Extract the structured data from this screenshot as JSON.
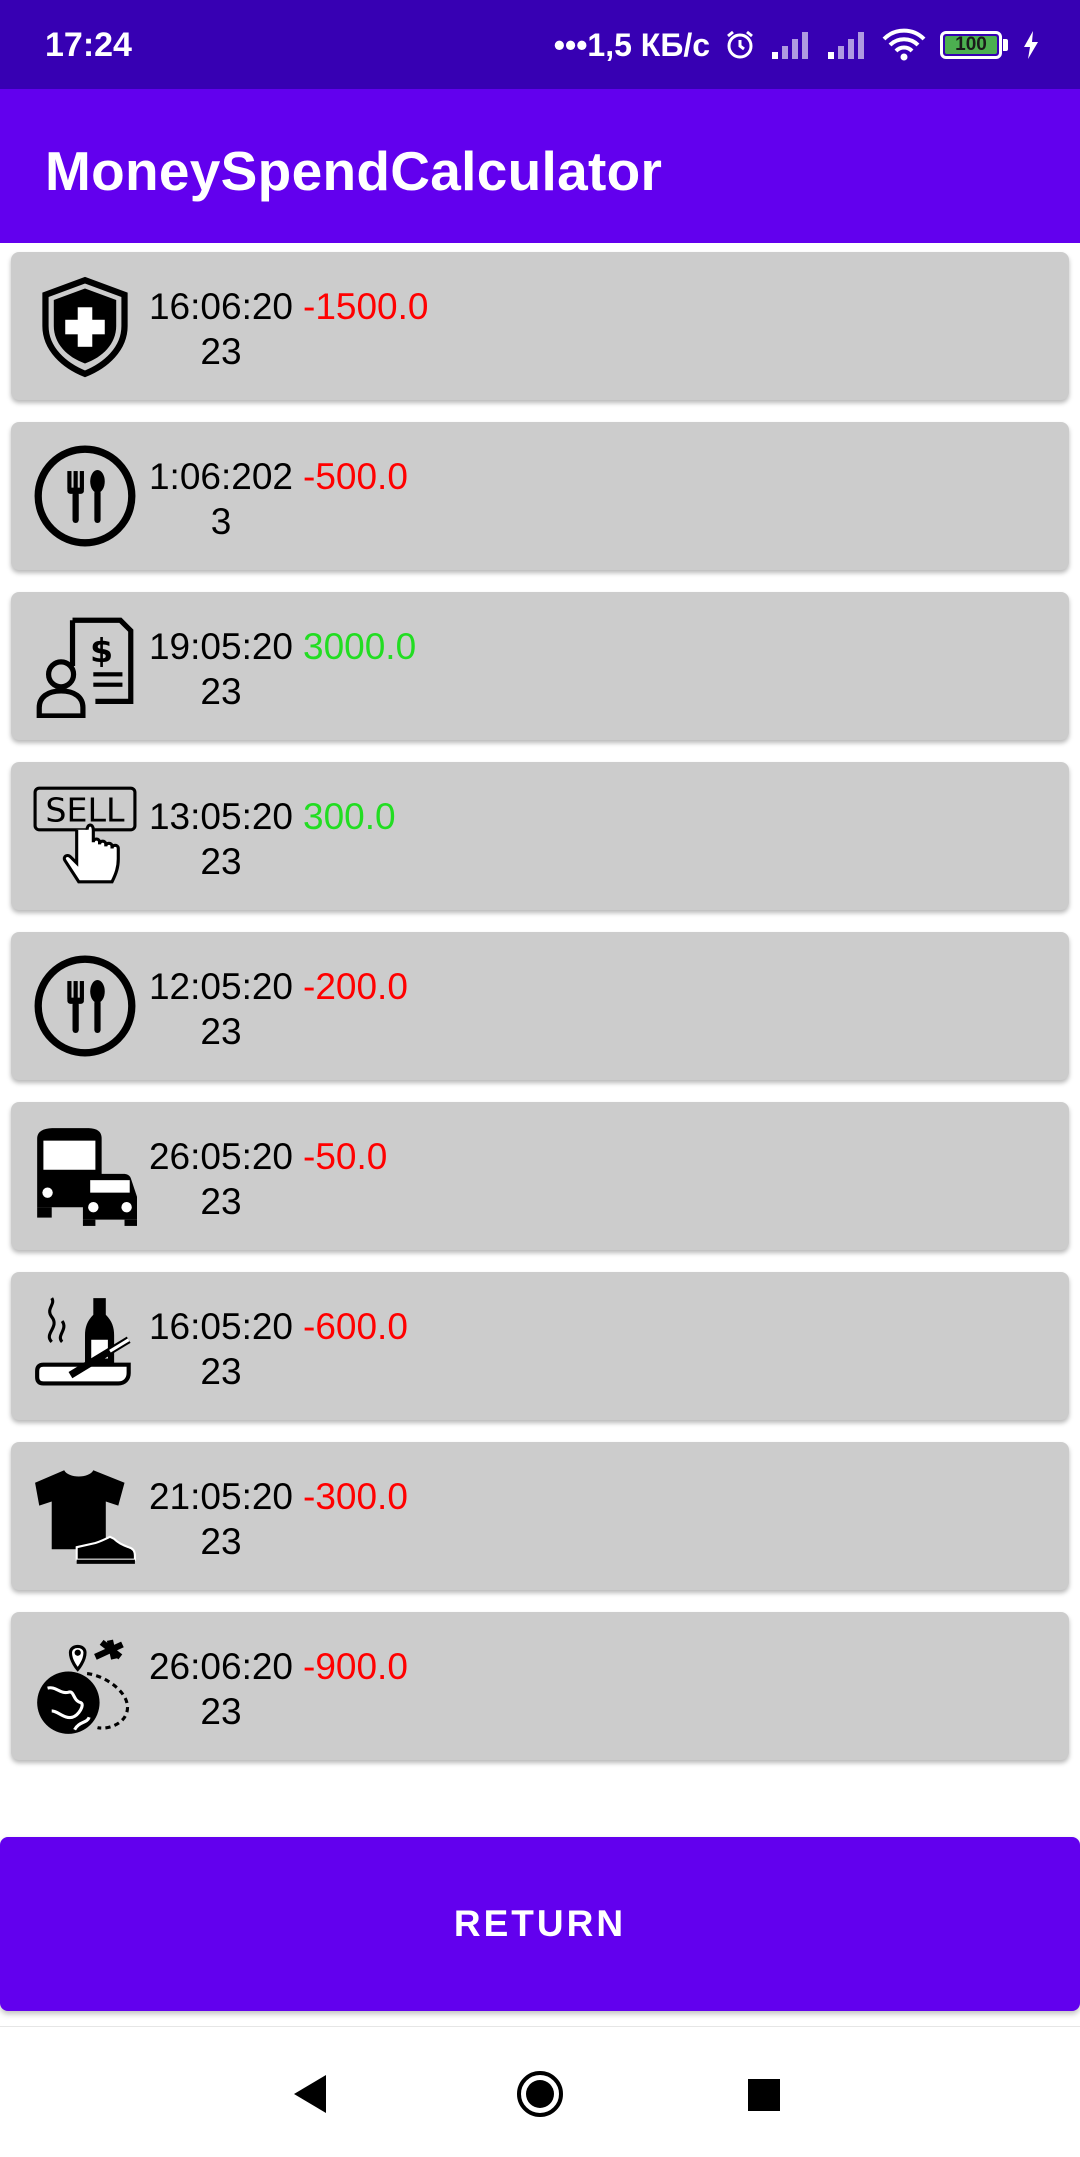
{
  "status_bar": {
    "time": "17:24",
    "speed": "•••1,5 КБ/с",
    "battery": "100"
  },
  "app_bar": {
    "title": "MoneySpendCalculator"
  },
  "transactions": [
    {
      "icon": "health-shield-icon",
      "date": "16:06:2023",
      "amount": "-1500.0",
      "type": "expense"
    },
    {
      "icon": "food-fork-spoon-icon",
      "date": "1:06:2023",
      "amount": "-500.0",
      "type": "expense"
    },
    {
      "icon": "salary-document-icon",
      "date": "19:05:2023",
      "amount": "3000.0",
      "type": "income"
    },
    {
      "icon": "sell-hand-icon",
      "date": "13:05:2023",
      "amount": "300.0",
      "type": "income"
    },
    {
      "icon": "food-fork-spoon-icon",
      "date": "12:05:2023",
      "amount": "-200.0",
      "type": "expense"
    },
    {
      "icon": "transport-bus-car-icon",
      "date": "26:05:2023",
      "amount": "-50.0",
      "type": "expense"
    },
    {
      "icon": "bad-habits-bottle-cigarette-icon",
      "date": "16:05:2023",
      "amount": "-600.0",
      "type": "expense"
    },
    {
      "icon": "clothes-tshirt-shoe-icon",
      "date": "21:05:2023",
      "amount": "-300.0",
      "type": "expense"
    },
    {
      "icon": "travel-globe-plane-icon",
      "date": "26:06:2023",
      "amount": "-900.0",
      "type": "expense"
    }
  ],
  "return_button": {
    "label": "RETURN"
  },
  "nav": {
    "back": "back-icon",
    "home": "home-icon",
    "recent": "recent-apps-icon"
  },
  "colors": {
    "status_bar": "#3700B3",
    "primary": "#6200EE",
    "card": "#CCCCCC",
    "expense": "#FF0000",
    "income": "#22DD22"
  }
}
